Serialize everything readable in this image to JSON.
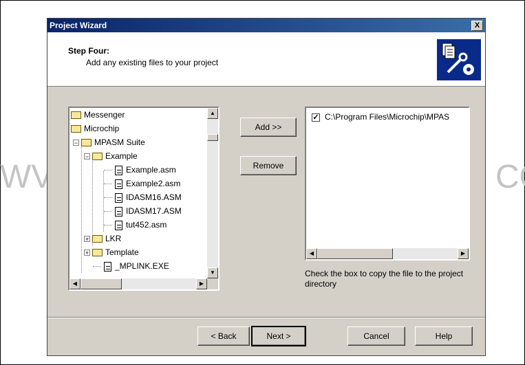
{
  "watermark": {
    "left": "WV",
    "right": "CO"
  },
  "window": {
    "title": "Project Wizard",
    "close_label": "X"
  },
  "header": {
    "step_title": "Step Four:",
    "step_subtitle": "Add any existing files to your project",
    "icon": "wizard-tools-icon"
  },
  "tree": {
    "items": [
      {
        "label": "Messenger",
        "type": "folder"
      },
      {
        "label": "Microchip",
        "type": "folder"
      },
      {
        "label": "MPASM Suite",
        "type": "folder",
        "expander": "−"
      },
      {
        "label": "Example",
        "type": "folder",
        "expander": "−"
      },
      {
        "label": "Example.asm",
        "type": "file"
      },
      {
        "label": "Example2.asm",
        "type": "file"
      },
      {
        "label": "IDASM16.ASM",
        "type": "file"
      },
      {
        "label": "IDASM17.ASM",
        "type": "file"
      },
      {
        "label": "tut452.asm",
        "type": "file"
      },
      {
        "label": "LKR",
        "type": "folder",
        "expander": "+"
      },
      {
        "label": "Template",
        "type": "folder",
        "expander": "+"
      },
      {
        "label": "_MPLINK.EXE",
        "type": "file"
      }
    ]
  },
  "actions": {
    "add_label": "Add >>",
    "remove_label": "Remove"
  },
  "files": {
    "items": [
      {
        "checked": true,
        "check_mark": "✓",
        "path": "C:\\Program Files\\Microchip\\MPAS"
      }
    ]
  },
  "hint": "Check the box to copy the file to the project directory",
  "footer": {
    "back_label": "< Back",
    "next_label": "Next >",
    "cancel_label": "Cancel",
    "help_label": "Help"
  },
  "scroll_arrows": {
    "up": "▲",
    "down": "▼",
    "left": "◀",
    "right": "▶"
  }
}
